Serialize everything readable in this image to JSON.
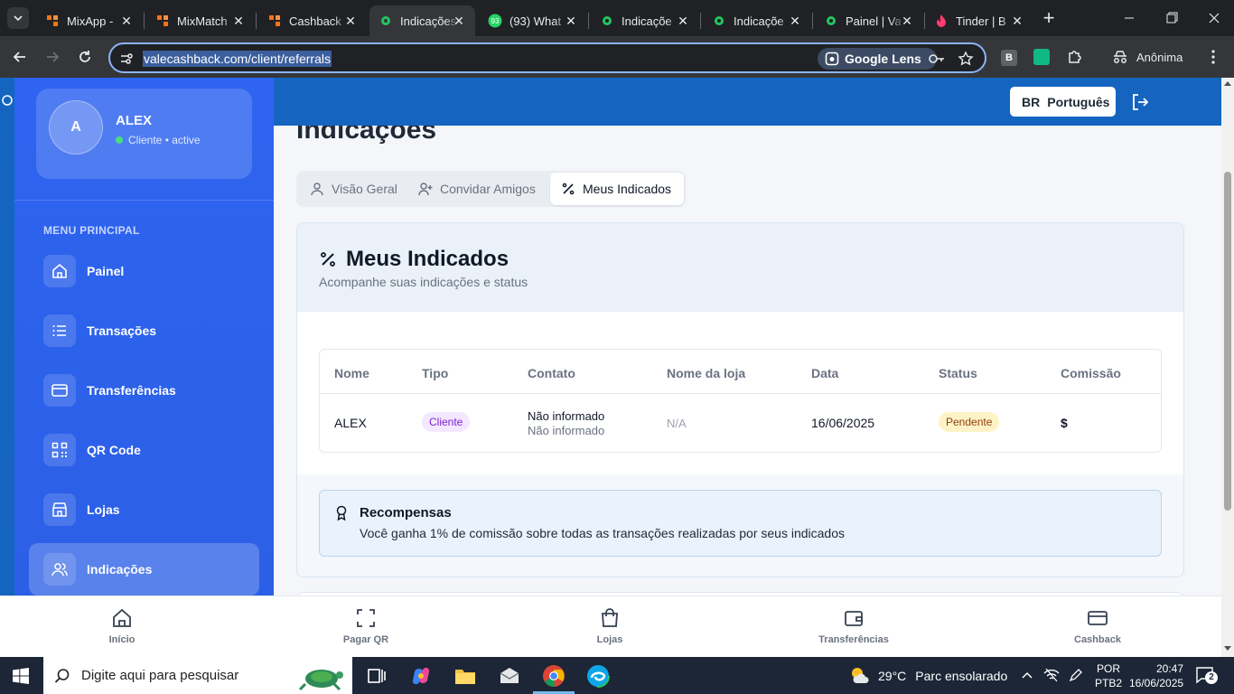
{
  "browser": {
    "tabs": [
      {
        "title": "MixApp - ",
        "active": false
      },
      {
        "title": "MixMatch",
        "active": false
      },
      {
        "title": "Cashback",
        "active": false
      },
      {
        "title": "Indicações",
        "active": true
      },
      {
        "title": "(93) What",
        "active": false
      },
      {
        "title": "Indicaçõe",
        "active": false
      },
      {
        "title": "Indicaçõe",
        "active": false
      },
      {
        "title": "Painel | Va",
        "active": false
      },
      {
        "title": "Tinder | B",
        "active": false
      }
    ],
    "url": "valecashback.com/client/referrals",
    "lens_label": "Google Lens",
    "profile_label": "Anônima",
    "whatsapp_badge": "93",
    "ext_b": "B"
  },
  "user": {
    "avatar_letter": "A",
    "name": "ALEX",
    "status": "Cliente • active"
  },
  "sidebar": {
    "section_title": "MENU PRINCIPAL",
    "items": [
      {
        "label": "Painel",
        "icon": "home-icon"
      },
      {
        "label": "Transações",
        "icon": "list-icon"
      },
      {
        "label": "Transferências",
        "icon": "card-icon"
      },
      {
        "label": "QR Code",
        "icon": "qr-icon"
      },
      {
        "label": "Lojas",
        "icon": "store-icon"
      },
      {
        "label": "Indicações",
        "icon": "users-icon",
        "active": true
      }
    ]
  },
  "header": {
    "lang_code": "BR",
    "lang_label": "Português"
  },
  "main": {
    "page_title": "Indicações",
    "tabs": [
      {
        "label": "Visão Geral"
      },
      {
        "label": "Convidar Amigos"
      },
      {
        "label": "Meus Indicados",
        "active": true
      }
    ],
    "card_title": "Meus Indicados",
    "card_subtitle": "Acompanhe suas indicações e status",
    "table": {
      "headers": [
        "Nome",
        "Tipo",
        "Contato",
        "Nome da loja",
        "Data",
        "Status",
        "Comissão"
      ],
      "rows": [
        {
          "nome": "ALEX",
          "tipo": "Cliente",
          "contato1": "Não informado",
          "contato2": "Não informado",
          "loja": "N/A",
          "data": "16/06/2025",
          "status": "Pendente",
          "comissao": "$"
        }
      ]
    },
    "rewards": {
      "title": "Recompensas",
      "text": "Você ganha 1% de comissão sobre todas as transações realizadas por seus indicados"
    }
  },
  "bottom_nav": [
    {
      "label": "Início"
    },
    {
      "label": "Pagar QR"
    },
    {
      "label": "Lojas"
    },
    {
      "label": "Transferências"
    },
    {
      "label": "Cashback"
    }
  ],
  "taskbar": {
    "search_placeholder": "Digite aqui para pesquisar",
    "weather_temp": "29°C",
    "weather_desc": "Parc ensolarado",
    "lang1": "POR",
    "lang2": "PTB2",
    "time": "20:47",
    "date": "16/06/2025",
    "notif_count": "2"
  },
  "colors": {
    "sidebar_blue": "#2b5fe6",
    "header_blue": "#1565c0",
    "tag_cliente_bg": "#f3e8ff",
    "tag_cliente_fg": "#7e22ce",
    "tag_pendente_bg": "#fef3c7",
    "tag_pendente_fg": "#92400e",
    "status_dot": "#4ade80"
  }
}
